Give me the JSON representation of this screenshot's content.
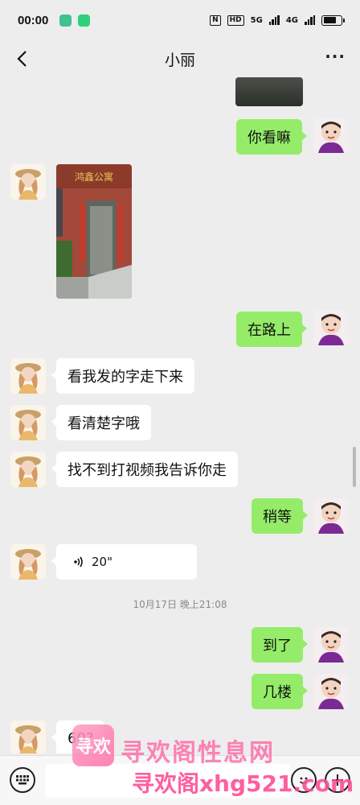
{
  "status_bar": {
    "time": "00:00",
    "network": "5G",
    "network2": "4G",
    "hd": "HD",
    "battery_level": 0.75
  },
  "header": {
    "title": "小丽"
  },
  "messages": [
    {
      "dir": "out",
      "kind": "image"
    },
    {
      "dir": "out",
      "kind": "text",
      "text": "你看嘛"
    },
    {
      "dir": "in",
      "kind": "image"
    },
    {
      "dir": "out",
      "kind": "text",
      "text": "在路上"
    },
    {
      "dir": "in",
      "kind": "text",
      "text": "看我发的字走下来"
    },
    {
      "dir": "in",
      "kind": "text",
      "text": "看清楚字哦"
    },
    {
      "dir": "in",
      "kind": "text",
      "text": "找不到打视频我告诉你走"
    },
    {
      "dir": "out",
      "kind": "text",
      "text": "稍等"
    },
    {
      "dir": "in",
      "kind": "voice",
      "text": "20\""
    },
    {
      "kind": "timestamp",
      "text": "10月17日 晚上21:08"
    },
    {
      "dir": "out",
      "kind": "text",
      "text": "到了"
    },
    {
      "dir": "out",
      "kind": "text",
      "text": "几楼"
    },
    {
      "dir": "in",
      "kind": "text",
      "text": "60?"
    }
  ],
  "photo_sign": "鸿鑫公寓",
  "watermark": {
    "logo_text": "寻欢",
    "name": "寻欢阁性息网",
    "url": "寻欢阁xhg521.com"
  },
  "icons": [
    "back-arrow-icon",
    "more-icon",
    "voice-wave-icon",
    "keyboard-icon",
    "emoji-icon",
    "plus-icon"
  ],
  "colors": {
    "background": "#ededed",
    "out_bubble": "#95ec69",
    "in_bubble": "#ffffff",
    "watermark": "#ff6fa8"
  }
}
